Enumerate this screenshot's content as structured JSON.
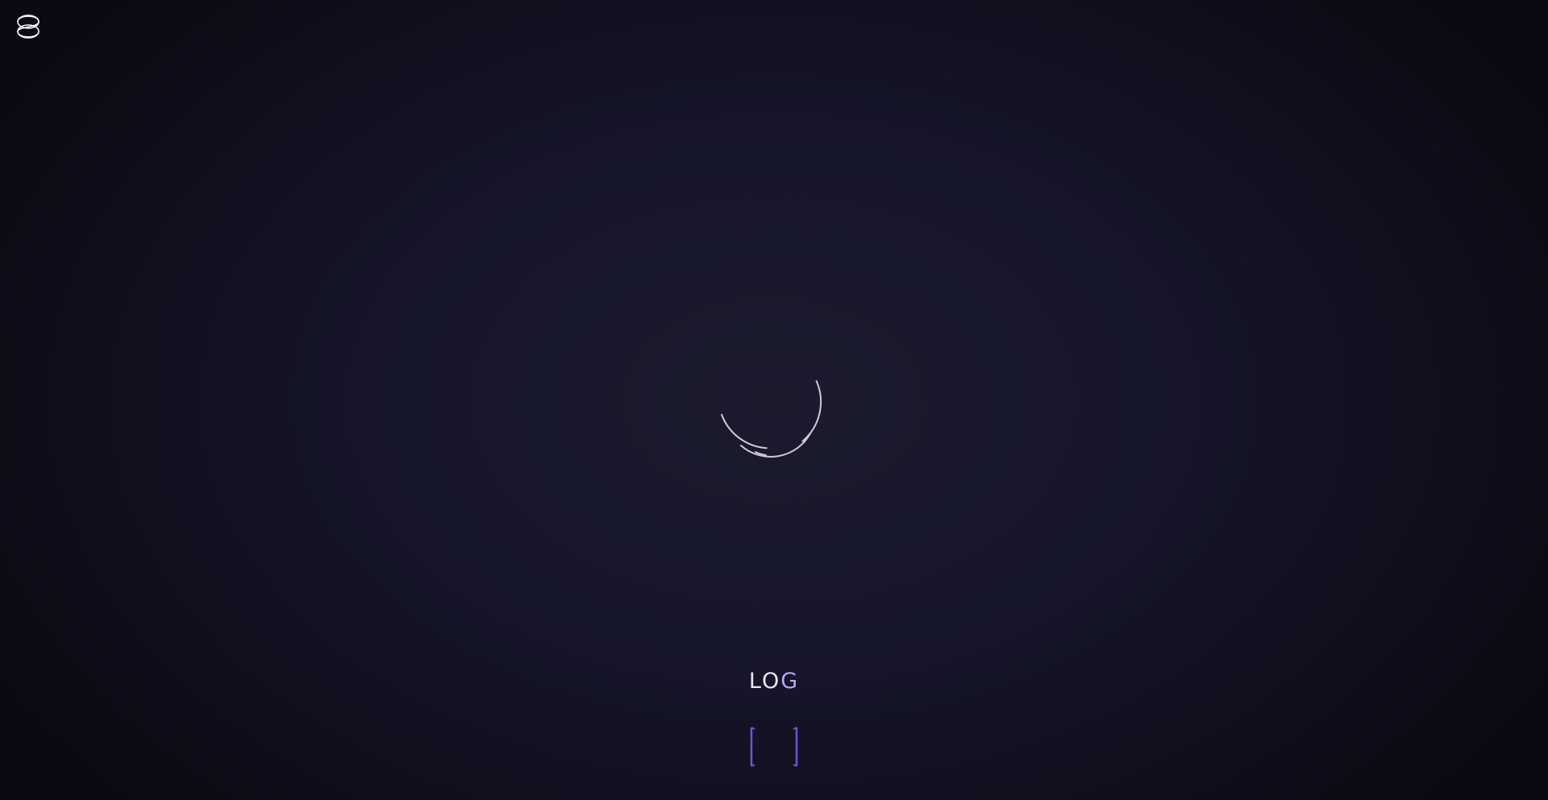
{
  "header": {
    "logo_icon": "brand-logo-icon"
  },
  "loader": {
    "icon": "spinner-arcs",
    "color": "#cfcad8"
  },
  "status": {
    "label_part1": "LO",
    "label_part2": "G",
    "label_color": "#e7e5f3",
    "label_accent": "#b7a7ee"
  },
  "progress_indicator": {
    "icon": "bracket-frame",
    "accent": "#6b55d6"
  }
}
